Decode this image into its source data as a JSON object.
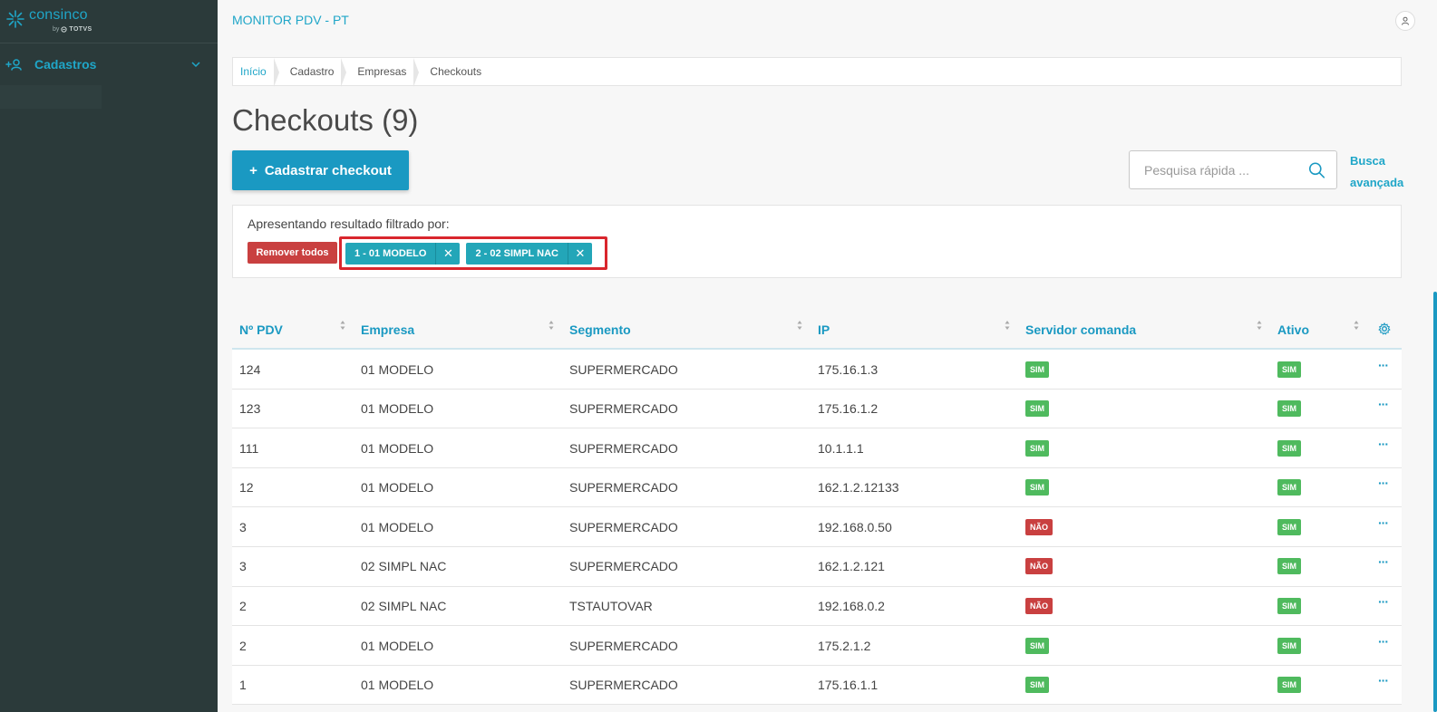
{
  "sidebar": {
    "logo_name": "consinco",
    "logo_by": "by",
    "logo_brand": "TOTVS",
    "menu": [
      {
        "label": "Cadastros"
      }
    ]
  },
  "header": {
    "title": "MONITOR PDV - PT"
  },
  "breadcrumb": [
    "Início",
    "Cadastro",
    "Empresas",
    "Checkouts"
  ],
  "page": {
    "title": "Checkouts (9)"
  },
  "actions": {
    "add_label": "Cadastrar checkout",
    "add_icon": "+",
    "search_placeholder": "Pesquisa rápida ...",
    "advanced_search": "Busca avançada"
  },
  "filters": {
    "title": "Apresentando resultado filtrado por:",
    "remove_all": "Remover todos",
    "chips": [
      {
        "label": "1 - 01 MODELO"
      },
      {
        "label": "2 - 02 SIMPL NAC"
      }
    ]
  },
  "table": {
    "columns": [
      "Nº PDV",
      "Empresa",
      "Segmento",
      "IP",
      "Servidor comanda",
      "Ativo"
    ],
    "rows": [
      {
        "pdv": "124",
        "empresa": "01 MODELO",
        "segmento": "SUPERMERCADO",
        "ip": "175.16.1.3",
        "servidor": "SIM",
        "ativo": "SIM"
      },
      {
        "pdv": "123",
        "empresa": "01 MODELO",
        "segmento": "SUPERMERCADO",
        "ip": "175.16.1.2",
        "servidor": "SIM",
        "ativo": "SIM"
      },
      {
        "pdv": "111",
        "empresa": "01 MODELO",
        "segmento": "SUPERMERCADO",
        "ip": "10.1.1.1",
        "servidor": "SIM",
        "ativo": "SIM"
      },
      {
        "pdv": "12",
        "empresa": "01 MODELO",
        "segmento": "SUPERMERCADO",
        "ip": "162.1.2.12133",
        "servidor": "SIM",
        "ativo": "SIM"
      },
      {
        "pdv": "3",
        "empresa": "01 MODELO",
        "segmento": "SUPERMERCADO",
        "ip": "192.168.0.50",
        "servidor": "NÃO",
        "ativo": "SIM"
      },
      {
        "pdv": "3",
        "empresa": "02 SIMPL NAC",
        "segmento": "SUPERMERCADO",
        "ip": "162.1.2.121",
        "servidor": "NÃO",
        "ativo": "SIM"
      },
      {
        "pdv": "2",
        "empresa": "02 SIMPL NAC",
        "segmento": "TSTAUTOVAR",
        "ip": "192.168.0.2",
        "servidor": "NÃO",
        "ativo": "SIM"
      },
      {
        "pdv": "2",
        "empresa": "01 MODELO",
        "segmento": "SUPERMERCADO",
        "ip": "175.2.1.2",
        "servidor": "SIM",
        "ativo": "SIM"
      },
      {
        "pdv": "1",
        "empresa": "01 MODELO",
        "segmento": "SUPERMERCADO",
        "ip": "175.16.1.1",
        "servidor": "SIM",
        "ativo": "SIM"
      }
    ],
    "row_menu": "···"
  },
  "colors": {
    "accent": "#1a99c2",
    "sidebar_bg": "#2b3a3a",
    "badge_yes": "#4fba5e",
    "badge_no": "#c94040",
    "chip": "#23a6b8"
  }
}
